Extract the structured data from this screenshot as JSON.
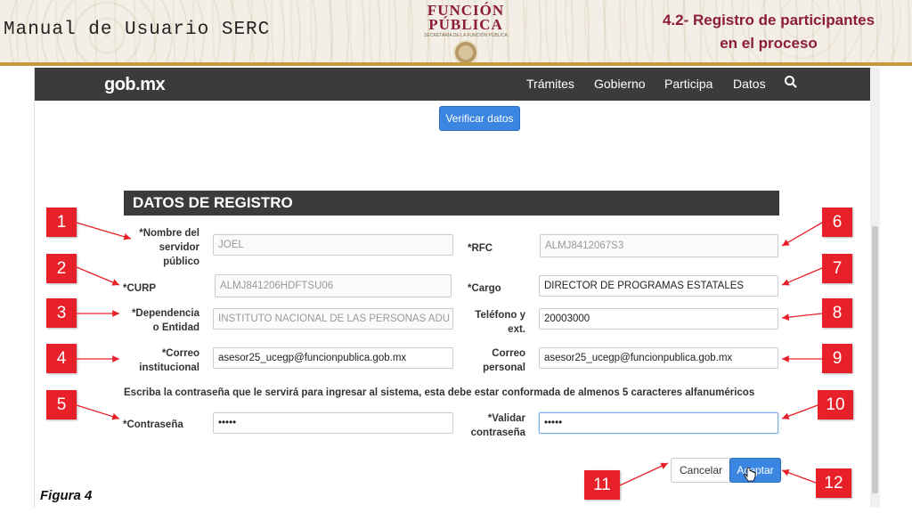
{
  "slide": {
    "manual_title": "Manual de Usuario SERC",
    "logo": {
      "line1": "FUNCIÓN",
      "line2": "PÚBLICA",
      "sub": "SECRETARÍA DE LA FUNCIÓN PÚBLICA"
    },
    "section_title_line1": "4.2- Registro de participantes",
    "section_title_line2": "en el proceso",
    "figure_label": "Figura 4"
  },
  "navbar": {
    "brand": "gob.mx",
    "items": [
      "Trámites",
      "Gobierno",
      "Participa",
      "Datos"
    ],
    "search_icon": "search-icon"
  },
  "verify_button": "Verificar datos",
  "form": {
    "header": "DATOS DE REGISTRO",
    "nombre_label": "*Nombre del servidor público",
    "nombre_value": "JOEL",
    "rfc_label": "*RFC",
    "rfc_value": "ALMJ8412067S3",
    "curp_label": "*CURP",
    "curp_value": "ALMJ841206HDFTSU06",
    "cargo_label": "*Cargo",
    "cargo_value": "DIRECTOR DE PROGRAMAS ESTATALES",
    "dependencia_label": "*Dependencia o Entidad",
    "dependencia_value": "INSTITUTO NACIONAL DE LAS PERSONAS ADU",
    "telefono_label": "Teléfono y ext.",
    "telefono_value": "20003000",
    "correo_inst_label": "*Correo institucional",
    "correo_inst_value": "asesor25_ucegp@funcionpublica.gob.mx",
    "correo_personal_label": "Correo personal",
    "correo_personal_value": "asesor25_ucegp@funcionpublica.gob.mx",
    "password_note": "Escriba la contraseña que le servirá para ingresar al sistema, esta debe estar conformada de almenos 5 caracteres alfanuméricos",
    "password_label": "*Contraseña",
    "password_value": "•••••",
    "confirm_label": "*Validar contraseña",
    "confirm_value": "•••••"
  },
  "buttons": {
    "cancel": "Cancelar",
    "accept": "Aceptar"
  },
  "callouts": [
    "1",
    "2",
    "3",
    "4",
    "5",
    "6",
    "7",
    "8",
    "9",
    "10",
    "11",
    "12"
  ],
  "colors": {
    "callout": "#e8202a",
    "brand_wine": "#8c1d3b",
    "gold": "#c49a3a",
    "navbar": "#3b3b3b",
    "primary_button": "#3b86e0"
  }
}
